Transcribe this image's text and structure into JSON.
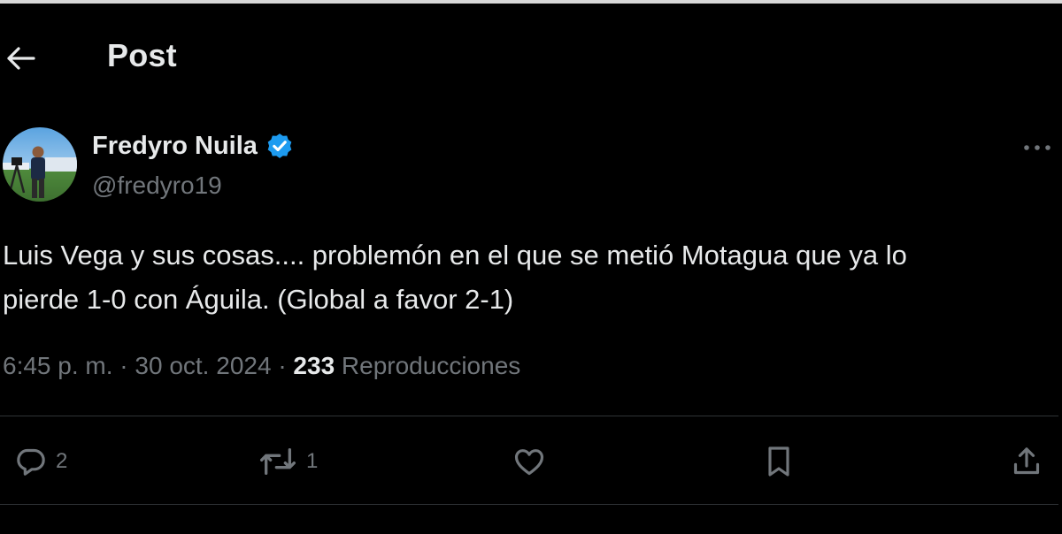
{
  "header": {
    "title": "Post"
  },
  "author": {
    "name": "Fredyro Nuila",
    "handle": "@fredyro19",
    "verified": true
  },
  "post": {
    "text": "Luis Vega y sus cosas.... problemón en el que se metió Motagua que ya lo\npierde 1-0 con Águila. (Global a favor 2-1)",
    "time": "6:45 p. m.",
    "date": "30 oct. 2024",
    "separator": "·",
    "views_count": "233",
    "views_label": "Reproducciones"
  },
  "actions": {
    "reply_count": "2",
    "repost_count": "1"
  },
  "icons": {
    "back": "arrow-left-icon",
    "verified": "verified-badge-icon",
    "more": "more-horizontal-icon",
    "reply": "reply-icon",
    "repost": "repost-icon",
    "like": "heart-icon",
    "bookmark": "bookmark-icon",
    "share": "share-icon"
  },
  "colors": {
    "background": "#000000",
    "text": "#e7e9ea",
    "muted": "#71767b",
    "verified": "#1d9bf0",
    "divider": "#2f3336"
  }
}
